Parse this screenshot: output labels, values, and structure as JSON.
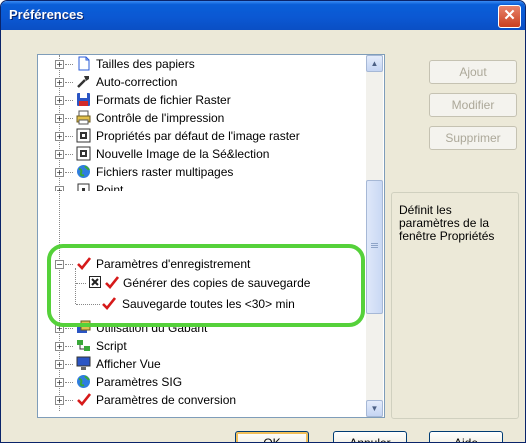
{
  "window": {
    "title": "Préférences"
  },
  "tree": {
    "items": [
      {
        "label": "Tailles des papiers",
        "icon": "paper-icon"
      },
      {
        "label": "Auto-correction",
        "icon": "wrench-icon"
      },
      {
        "label": "Formats de fichier Raster",
        "icon": "floppy-disk-icon"
      },
      {
        "label": "Contrôle de l'impression",
        "icon": "printer-icon"
      },
      {
        "label": "Propriétés par défaut de l'image raster",
        "icon": "raster-properties-icon"
      },
      {
        "label": "Nouvelle Image de la Sé&lection",
        "icon": "new-image-icon"
      },
      {
        "label": "Fichiers raster multipages",
        "icon": "globe-icon"
      },
      {
        "label": "Point",
        "icon": "point-icon"
      },
      {
        "label": "Paramètres d'enregistrement",
        "icon": "checkmark-icon"
      },
      {
        "label": "Générer des copies de sauvegarde",
        "icon": "checkmark-icon",
        "checked": true
      },
      {
        "label": "Sauvegarde toutes les <30> min",
        "icon": "checkmark-icon"
      },
      {
        "label": "Utilisation du Gabarit",
        "icon": "template-icon"
      },
      {
        "label": "Script",
        "icon": "script-icon"
      },
      {
        "label": "Afficher Vue",
        "icon": "monitor-icon"
      },
      {
        "label": "Paramètres SIG",
        "icon": "globe-icon"
      },
      {
        "label": "Paramètres de conversion",
        "icon": "checkmark-icon"
      }
    ]
  },
  "side_buttons": {
    "add": "Ajout",
    "modify": "Modifier",
    "delete": "Supprimer"
  },
  "description": "Définit les paramètres de la fenêtre Propriétés",
  "bottom_buttons": {
    "ok": "OK",
    "cancel": "Annuler",
    "help": "Aide"
  },
  "colors": {
    "titlebar": "#0b58d3",
    "highlight": "#55d13a",
    "checkmark": "#d61a1a"
  }
}
